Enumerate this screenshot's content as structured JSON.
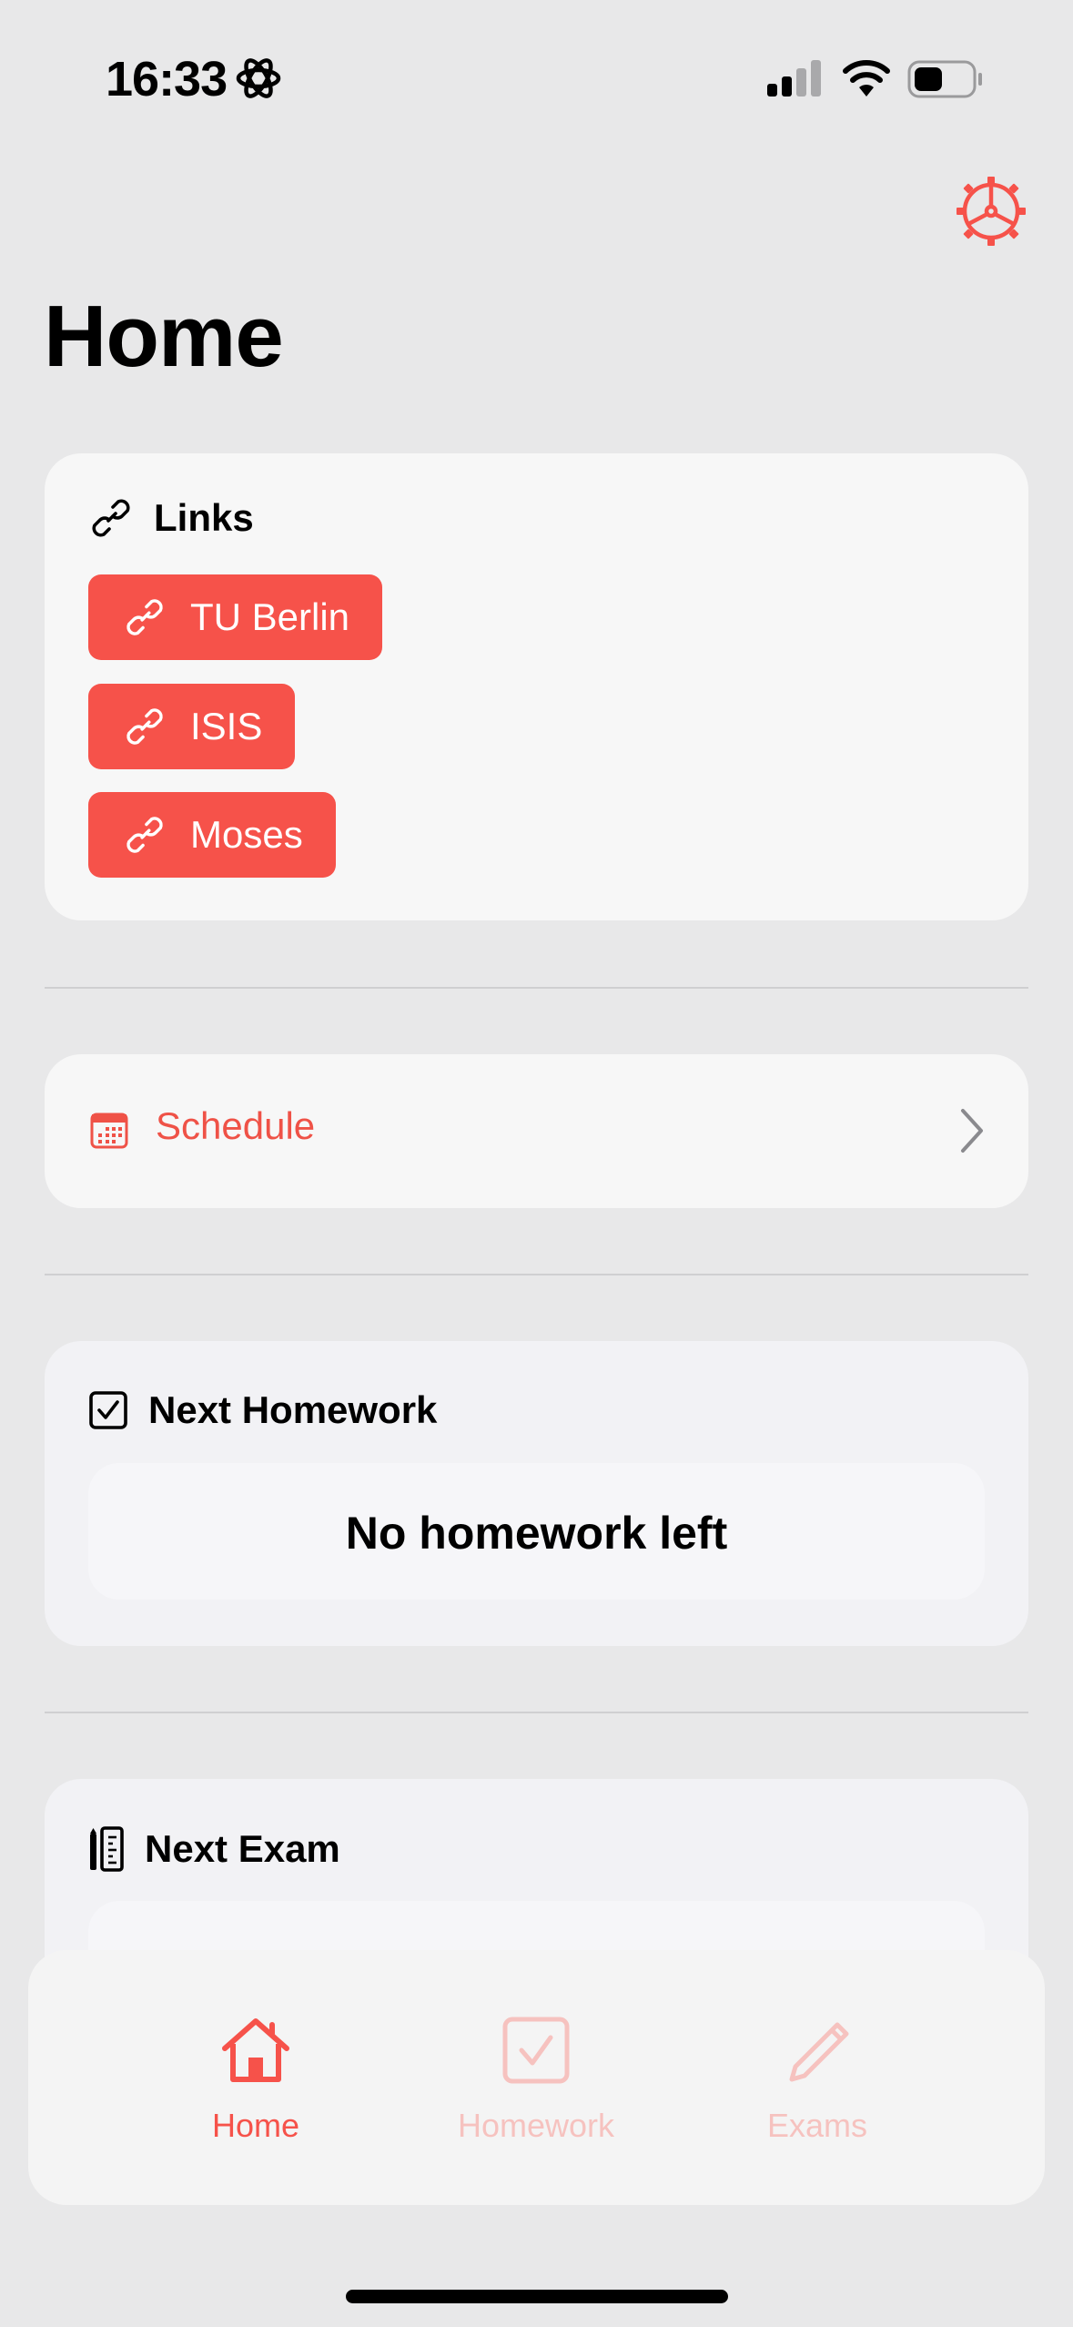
{
  "status_bar": {
    "time": "16:33"
  },
  "page": {
    "title": "Home"
  },
  "links_card": {
    "title": "Links",
    "items": [
      {
        "label": "TU Berlin"
      },
      {
        "label": "ISIS"
      },
      {
        "label": "Moses"
      }
    ]
  },
  "schedule": {
    "label": "Schedule"
  },
  "homework_card": {
    "title": "Next Homework",
    "empty_text": "No homework left"
  },
  "exam_card": {
    "title": "Next Exam"
  },
  "tab_bar": {
    "tabs": [
      {
        "label": "Home",
        "icon": "house-icon",
        "selected": true
      },
      {
        "label": "Homework",
        "icon": "checkbox-icon",
        "selected": false
      },
      {
        "label": "Exams",
        "icon": "pencil-icon",
        "selected": false
      }
    ]
  },
  "colors": {
    "accent": "#f6524a",
    "accent_text": "#ef5247",
    "accent_faded": "#f6c2bf",
    "background": "#e8e8e9",
    "card": "#f7f7f7"
  }
}
